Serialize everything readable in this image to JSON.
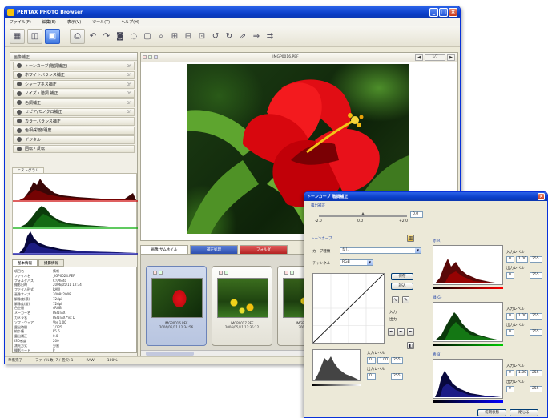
{
  "main_window": {
    "title": "PENTAX PHOTO Browser",
    "menu": [
      "ファイル(F)",
      "編集(E)",
      "表示(V)",
      "ツール(T)",
      "ヘルプ(H)"
    ],
    "toolbar_icons": [
      "thumbnail-grid-icon",
      "split-view-icon",
      "single-view-icon",
      "print-icon",
      "undo-icon",
      "redo-icon",
      "camera-icon",
      "rotate-left-icon",
      "frame-icon",
      "zoom-icon",
      "compare-icon",
      "compare-split-icon",
      "raw-icon",
      "undo-arrow-icon",
      "redo-arrow-icon",
      "send-icon",
      "export-icon",
      "share-icon"
    ],
    "toolbar_active_index": 2
  },
  "adjust_panel": {
    "header": "画像補正",
    "items": [
      {
        "label": "トーンカーブ(階調補正)",
        "icon": "tone-curve-icon",
        "tag": "Off"
      },
      {
        "label": "ホワイトバランス補正",
        "icon": "white-balance-icon",
        "tag": "Off"
      },
      {
        "label": "シャープネス補正",
        "icon": "sharpness-icon",
        "tag": "Off"
      },
      {
        "label": "ノイズ・階調 補正",
        "icon": "noise-icon",
        "tag": "Off"
      },
      {
        "label": "色調補正",
        "icon": "hue-icon",
        "tag": "Off"
      },
      {
        "label": "セピア/モノクロ補正",
        "icon": "sepia-icon",
        "tag": "Off"
      },
      {
        "label": "カラーバランス補正",
        "icon": "color-balance-icon",
        "tag": ""
      },
      {
        "label": "色相/彩度/明度",
        "icon": "hsl-icon",
        "tag": ""
      },
      {
        "label": "デジタル",
        "icon": "digital-icon",
        "tag": ""
      },
      {
        "label": "回転・反転",
        "icon": "rotate-icon",
        "tag": ""
      }
    ]
  },
  "histogram_tab": "ヒストグラム",
  "info_tabs": [
    "基本情報",
    "撮影情報"
  ],
  "info_rows": [
    [
      "項目名",
      "情報"
    ],
    [
      "ファイル名",
      "_IGP0024.PEF"
    ],
    [
      "フォルダパス",
      "C:\\Photo"
    ],
    [
      "撮影日時",
      "2006/05/11 12:34"
    ],
    [
      "ファイル形式",
      "RAW"
    ],
    [
      "画像サイズ",
      "3008x2008"
    ],
    [
      "解像度(横)",
      "72dpi"
    ],
    [
      "解像度(縦)",
      "72dpi"
    ],
    [
      "色空間",
      "sRGB"
    ],
    [
      "メーカー名",
      "PENTAX"
    ],
    [
      "カメラ名",
      "PENTAX *ist D"
    ],
    [
      "ソフトウェア",
      "Ver 1.00"
    ],
    [
      "露出時間",
      "1/125"
    ],
    [
      "絞り値",
      "F5.6"
    ],
    [
      "露出補正",
      "0.0"
    ],
    [
      "ISO感度",
      "200"
    ],
    [
      "測光方式",
      "分割"
    ],
    [
      "撮影モード",
      "P"
    ]
  ],
  "viewer": {
    "filename": "IMGP0016.PEF",
    "nav_prev": "◀",
    "nav_label": "1/7",
    "nav_next": "▶"
  },
  "strip_tabs": [
    "画像 サムネイル",
    "補正処理",
    "フォルダ"
  ],
  "thumbs": [
    {
      "caption": "IMGP0016.PEF\n2006/05/11 12:34:56"
    },
    {
      "caption": "IMGP0017.PEF\n2006/05/11 12:35:12"
    },
    {
      "caption": "IMGP0018.PEF\n2006/05/11"
    }
  ],
  "statusbar": [
    "準備完了",
    "ファイル数: 7 / 選択: 1",
    "RAW",
    "100%"
  ],
  "tone_dialog": {
    "title": "トーンカーブ 階調補正",
    "exposure_section": "露出補正",
    "exposure_value": "0.0",
    "exposure_scale": [
      "-2.0",
      "0.0",
      "+2.0"
    ],
    "tone_curve_section": "トーンカーブ",
    "curve_type_label": "カーブ種類",
    "curve_type_value": "なし",
    "channel_label": "チャンネル",
    "channel_value": "RGB",
    "save_button": "保存",
    "load_button": "読込",
    "input_label": "入力",
    "output_label": "出力",
    "input_level_label": "入力レベル",
    "output_level_label": "出力レベル",
    "level_low": "0",
    "level_gamma": "1.00",
    "level_high": "255",
    "channels": [
      {
        "name": "赤(R)",
        "color": "#c00000"
      },
      {
        "name": "緑(G)",
        "color": "#008000"
      },
      {
        "name": "青(B)",
        "color": "#000090"
      }
    ],
    "reset_button": "初期状態",
    "close_button": "閉じる"
  }
}
